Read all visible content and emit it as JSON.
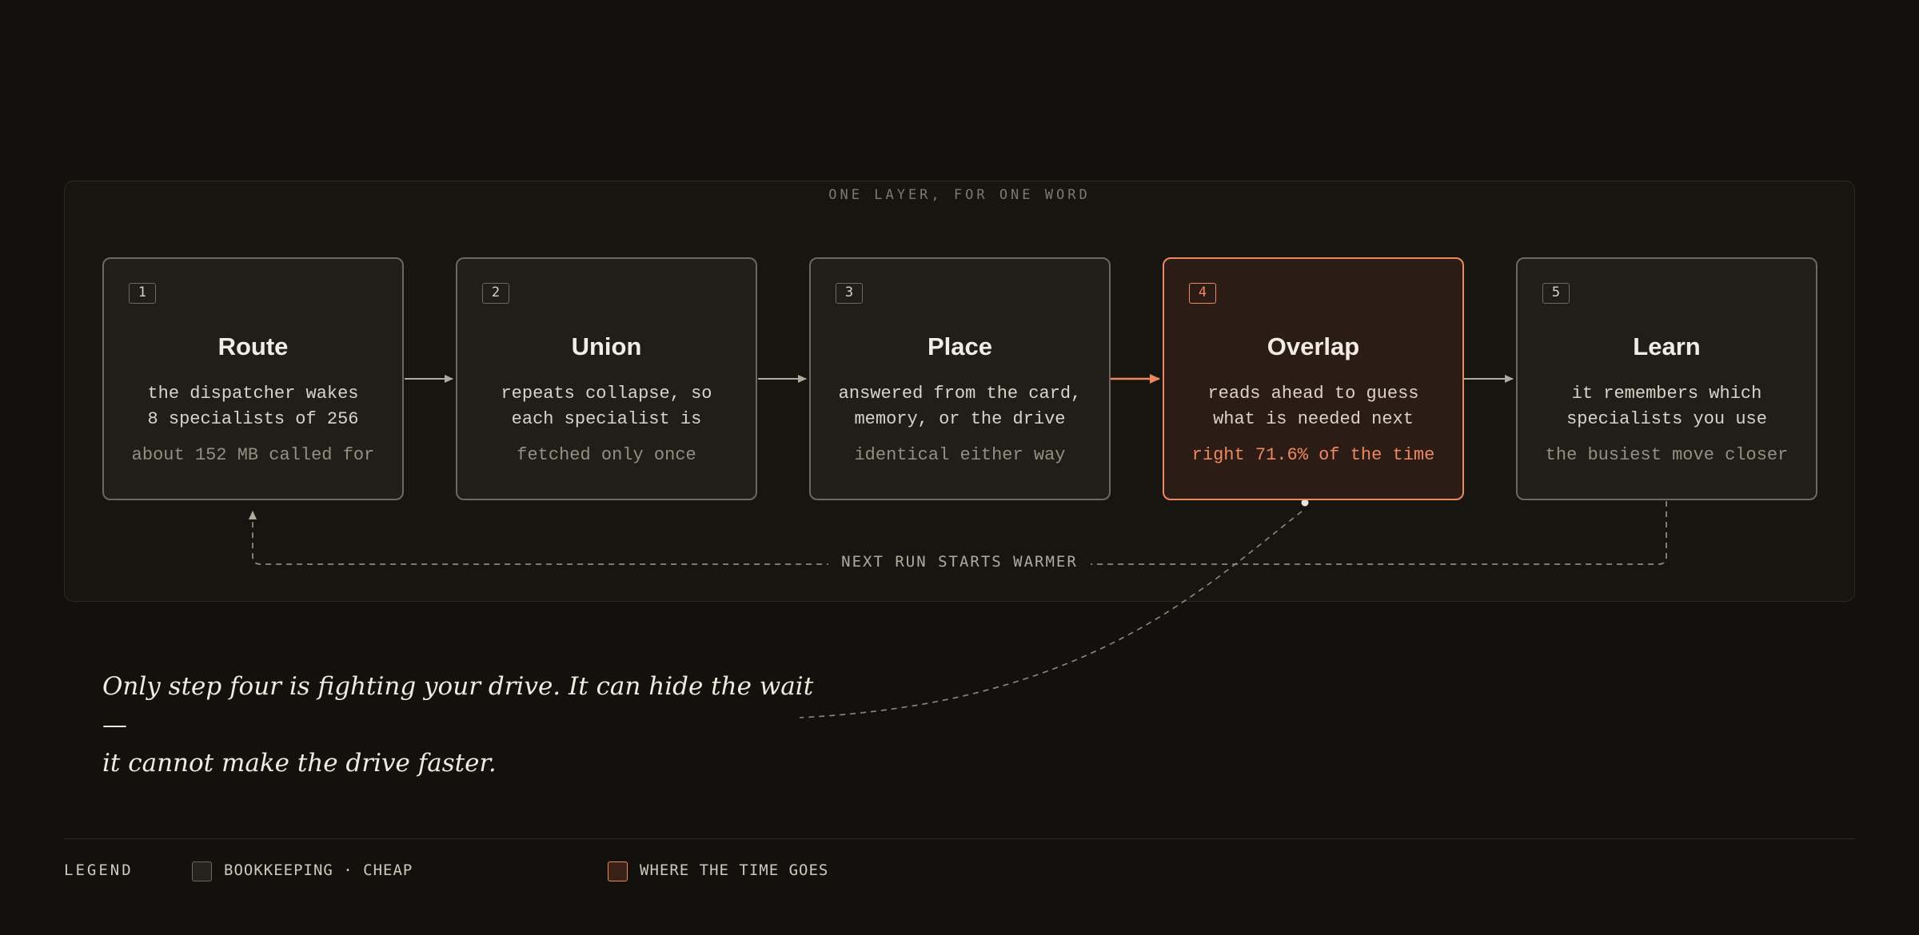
{
  "frame_title": "ONE LAYER, FOR ONE WORD",
  "colors": {
    "background": "#13110d",
    "card": "#201e19",
    "card_border": "#6e675c",
    "accent": "#f0885a"
  },
  "steps": [
    {
      "number": "1",
      "title": "Route",
      "desc_1": "the dispatcher wakes",
      "desc_2": "8 specialists of 256",
      "note": "about 152 MB called for",
      "highlight": false
    },
    {
      "number": "2",
      "title": "Union",
      "desc_1": "repeats collapse, so",
      "desc_2": "each specialist is",
      "note": "fetched only once",
      "highlight": false
    },
    {
      "number": "3",
      "title": "Place",
      "desc_1": "answered from the card,",
      "desc_2": "memory, or the drive",
      "note": "identical either way",
      "highlight": false
    },
    {
      "number": "4",
      "title": "Overlap",
      "desc_1": "reads ahead to guess",
      "desc_2": "what is needed next",
      "note": "right 71.6% of the time",
      "highlight": true
    },
    {
      "number": "5",
      "title": "Learn",
      "desc_1": "it remembers which",
      "desc_2": "specialists you use",
      "note": "the busiest move closer",
      "highlight": false
    }
  ],
  "loop_label": "NEXT RUN STARTS WARMER",
  "quote": {
    "line_1": "Only step four is fighting your drive. It can hide the wait —",
    "line_2": "it cannot make the drive faster."
  },
  "legend": {
    "title": "LEGEND",
    "items": [
      {
        "label": "BOOKKEEPING · CHEAP",
        "icon": "square-swatch-neutral"
      },
      {
        "label": "WHERE THE TIME GOES",
        "icon": "square-swatch-accent"
      }
    ]
  }
}
